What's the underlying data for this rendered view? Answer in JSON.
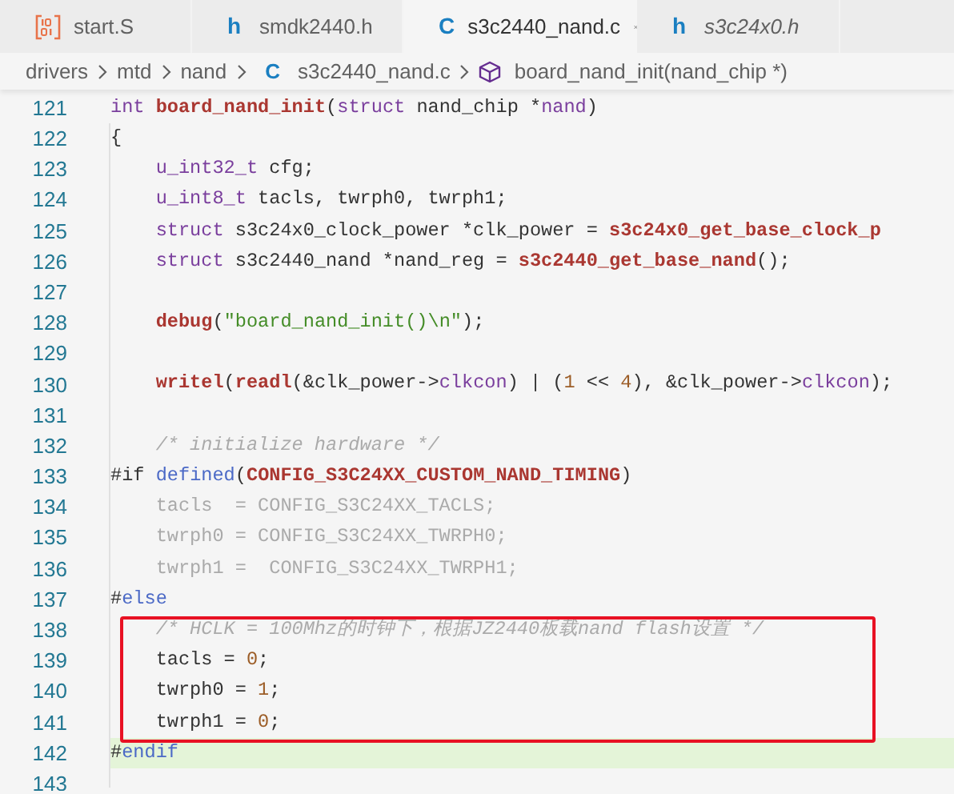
{
  "tabs": [
    {
      "label": "start.S",
      "kind": "binary",
      "selected": false,
      "preview": false
    },
    {
      "label": "smdk2440.h",
      "kind": "letter",
      "icon_text": "h",
      "selected": false,
      "preview": false
    },
    {
      "label": "s3c2440_nand.c",
      "kind": "letter",
      "icon_text": "C",
      "selected": true,
      "preview": false
    },
    {
      "label": "s3c24x0.h",
      "kind": "letter",
      "icon_text": "h",
      "selected": false,
      "preview": true
    }
  ],
  "breadcrumb": [
    {
      "kind": "folder",
      "label": "drivers"
    },
    {
      "kind": "folder",
      "label": "mtd"
    },
    {
      "kind": "folder",
      "label": "nand"
    },
    {
      "kind": "file",
      "icon_text": "C",
      "label": "s3c2440_nand.c"
    },
    {
      "kind": "symbol",
      "label": "board_nand_init(nand_chip *)"
    }
  ],
  "lines": [
    {
      "number": "121",
      "tokens": [
        {
          "kind": "kw",
          "text": "int "
        },
        {
          "kind": "fn",
          "text": "board_nand_init"
        },
        {
          "kind": "pl",
          "text": "("
        },
        {
          "kind": "kw",
          "text": "struct"
        },
        {
          "kind": "pl",
          "text": " nand_chip *"
        },
        {
          "kind": "kw",
          "text": "nand"
        },
        {
          "kind": "pl",
          "text": ")"
        }
      ]
    },
    {
      "number": "122",
      "tokens": [
        {
          "kind": "pl",
          "text": "{"
        }
      ]
    },
    {
      "number": "123",
      "tokens": [
        {
          "kind": "kw",
          "text": "    u_int32_t"
        },
        {
          "kind": "pl",
          "text": " cfg;"
        }
      ]
    },
    {
      "number": "124",
      "tokens": [
        {
          "kind": "kw",
          "text": "    u_int8_t"
        },
        {
          "kind": "pl",
          "text": " tacls, twrph0, twrph1;"
        }
      ]
    },
    {
      "number": "125",
      "tokens": [
        {
          "kind": "kw",
          "text": "    struct"
        },
        {
          "kind": "pl",
          "text": " s3c24x0_clock_power *clk_power = "
        },
        {
          "kind": "fn",
          "text": "s3c24x0_get_base_clock_p"
        }
      ]
    },
    {
      "number": "126",
      "tokens": [
        {
          "kind": "kw",
          "text": "    struct"
        },
        {
          "kind": "pl",
          "text": " s3c2440_nand *nand_reg = "
        },
        {
          "kind": "fn",
          "text": "s3c2440_get_base_nand"
        },
        {
          "kind": "pl",
          "text": "();"
        }
      ]
    },
    {
      "number": "127"
    },
    {
      "number": "128",
      "tokens": [
        {
          "kind": "fn",
          "text": "    debug"
        },
        {
          "kind": "pl",
          "text": "("
        },
        {
          "kind": "str",
          "text": "\"board_nand_init()\\n\""
        },
        {
          "kind": "pl",
          "text": ");"
        }
      ]
    },
    {
      "number": "129"
    },
    {
      "number": "130",
      "tokens": [
        {
          "kind": "fn",
          "text": "    writel"
        },
        {
          "kind": "pl",
          "text": "("
        },
        {
          "kind": "fn",
          "text": "readl"
        },
        {
          "kind": "pl",
          "text": "(&clk_power->"
        },
        {
          "kind": "kw",
          "text": "clkcon"
        },
        {
          "kind": "pl",
          "text": ") | ("
        },
        {
          "kind": "num",
          "text": "1"
        },
        {
          "kind": "pl",
          "text": " << "
        },
        {
          "kind": "num",
          "text": "4"
        },
        {
          "kind": "pl",
          "text": "), &clk_power->"
        },
        {
          "kind": "kw",
          "text": "clkcon"
        },
        {
          "kind": "pl",
          "text": ");"
        }
      ]
    },
    {
      "number": "131"
    },
    {
      "number": "132",
      "tokens": [
        {
          "kind": "cm",
          "text": "    /* initialize hardware */"
        }
      ]
    },
    {
      "number": "133",
      "tokens": [
        {
          "kind": "pl",
          "text": "#if "
        },
        {
          "kind": "blue",
          "text": "defined"
        },
        {
          "kind": "pl",
          "text": "("
        },
        {
          "kind": "fn",
          "text": "CONFIG_S3C24XX_CUSTOM_NAND_TIMING"
        },
        {
          "kind": "pl",
          "text": ")"
        }
      ]
    },
    {
      "number": "134",
      "tokens": [
        {
          "kind": "dim",
          "text": "    tacls  = CONFIG_S3C24XX_TACLS;"
        }
      ]
    },
    {
      "number": "135",
      "tokens": [
        {
          "kind": "dim",
          "text": "    twrph0 = CONFIG_S3C24XX_TWRPH0;"
        }
      ]
    },
    {
      "number": "136",
      "tokens": [
        {
          "kind": "dim",
          "text": "    twrph1 =  CONFIG_S3C24XX_TWRPH1;"
        }
      ]
    },
    {
      "number": "137",
      "tokens": [
        {
          "kind": "pl",
          "text": "#"
        },
        {
          "kind": "blue",
          "text": "else"
        }
      ]
    },
    {
      "number": "138",
      "boxed": true,
      "tokens": [
        {
          "kind": "cm",
          "text": "    /* HCLK = 100Mhz的时钟下，根据JZ2440板载nand flash设置 */"
        }
      ]
    },
    {
      "number": "139",
      "boxed": true,
      "tokens": [
        {
          "kind": "pl",
          "text": "    tacls = "
        },
        {
          "kind": "num",
          "text": "0"
        },
        {
          "kind": "pl",
          "text": ";"
        }
      ]
    },
    {
      "number": "140",
      "boxed": true,
      "tokens": [
        {
          "kind": "pl",
          "text": "    twrph0 = "
        },
        {
          "kind": "num",
          "text": "1"
        },
        {
          "kind": "pl",
          "text": ";"
        }
      ]
    },
    {
      "number": "141",
      "boxed": true,
      "tokens": [
        {
          "kind": "pl",
          "text": "    twrph1 = "
        },
        {
          "kind": "num",
          "text": "0"
        },
        {
          "kind": "pl",
          "text": ";"
        }
      ]
    },
    {
      "number": "142",
      "highlighted": true,
      "tokens": [
        {
          "kind": "pl",
          "text": "#"
        },
        {
          "kind": "blue",
          "text": "endif"
        }
      ]
    },
    {
      "number": "143"
    }
  ]
}
